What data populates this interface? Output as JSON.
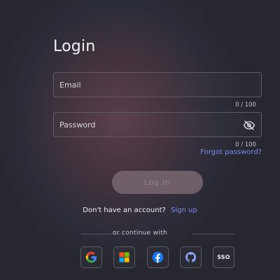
{
  "page": {
    "title": "Login"
  },
  "form": {
    "email": {
      "placeholder": "Email",
      "value": "",
      "counter": "0 / 100"
    },
    "password": {
      "placeholder": "Password",
      "value": "",
      "counter": "0 / 100",
      "toggle_icon": "eye-off-icon"
    },
    "forgot_link": "Forgot password?",
    "submit_label": "Log In"
  },
  "signup": {
    "prompt": "Don't have an account?",
    "link": "Sign up"
  },
  "social": {
    "divider_text": "or continue with",
    "providers": [
      {
        "name": "google",
        "icon": "google-icon"
      },
      {
        "name": "windows",
        "icon": "windows-icon"
      },
      {
        "name": "facebook",
        "icon": "facebook-icon"
      },
      {
        "name": "github",
        "icon": "github-icon"
      },
      {
        "name": "sso",
        "label": "SSO"
      }
    ]
  },
  "colors": {
    "link": "#7d8af0",
    "button_disabled_bg": "#6f5f68",
    "button_disabled_text": "#8f828b",
    "border": "#5f5a66",
    "background": "#2b2c38"
  }
}
